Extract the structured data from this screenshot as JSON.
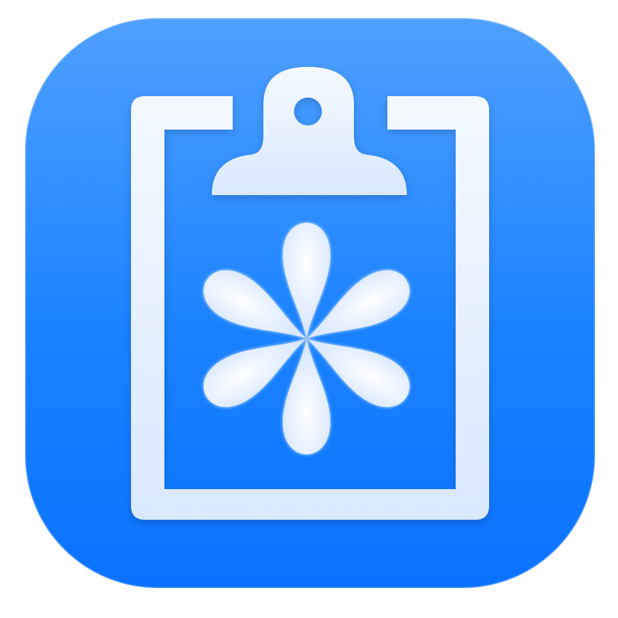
{
  "app_icon": {
    "name": "clipboard-asterisk-app-icon",
    "glyph": "clipboard-icon",
    "symbol": "asterisk-icon",
    "colors": {
      "background_top": "#4a9cff",
      "background_bottom": "#0a74ff",
      "glyph": "#eaf3ff",
      "glyph_shadow": "#cfe3ff"
    }
  }
}
